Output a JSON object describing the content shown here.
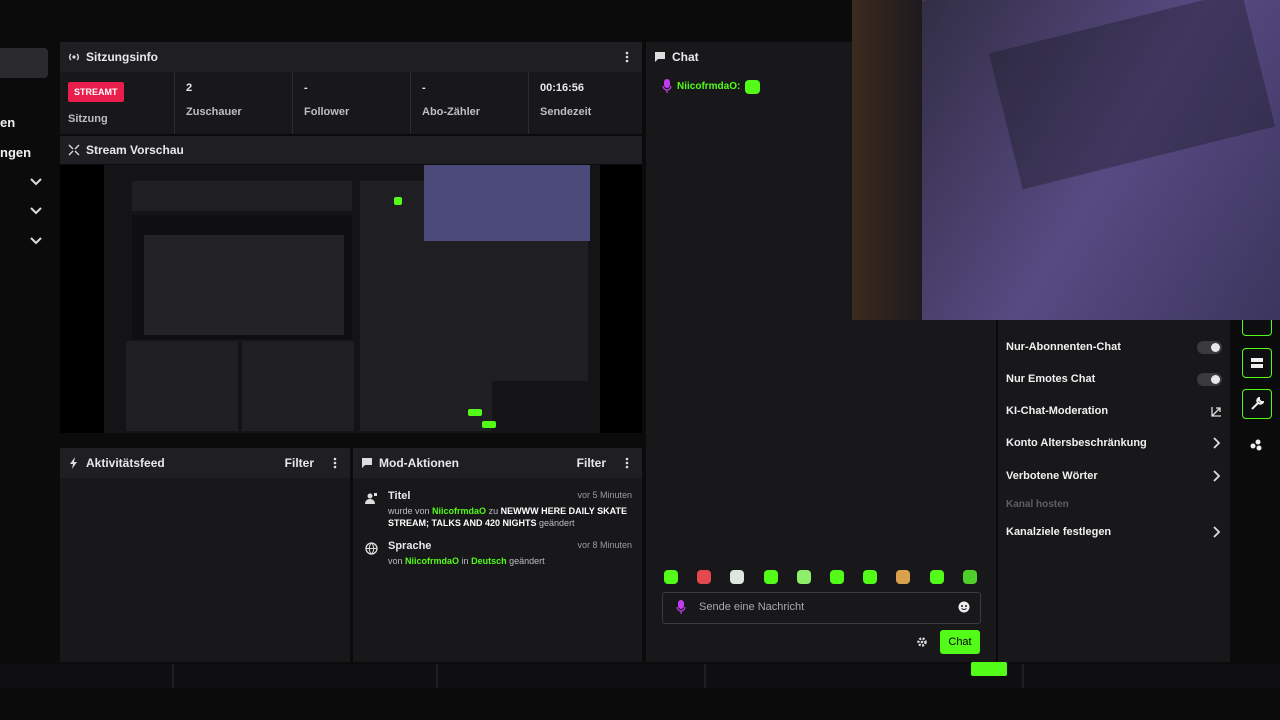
{
  "sidebar": {
    "labels": [
      "en",
      "ngen"
    ]
  },
  "session": {
    "title": "Sitzungsinfo",
    "live_badge": "STREAMT",
    "session_label": "Sitzung",
    "stats": [
      {
        "value": "2",
        "label": "Zuschauer"
      },
      {
        "value": "-",
        "label": "Follower"
      },
      {
        "value": "-",
        "label": "Abo-Zähler"
      },
      {
        "value": "00:16:56",
        "label": "Sendezeit"
      }
    ]
  },
  "preview": {
    "title": "Stream Vorschau"
  },
  "activity": {
    "title": "Aktivitätsfeed",
    "filter": "Filter"
  },
  "mod_actions": {
    "title": "Mod-Aktionen",
    "filter": "Filter",
    "items": [
      {
        "title": "Titel",
        "ago": "vor 5 Minuten",
        "pre": "wurde von",
        "user": "NiicofrmdaO",
        "mid": "zu",
        "target": "NEWWW HERE DAILY SKATE STREAM; TALKS AND 420 NIGHTS",
        "post": "geändert"
      },
      {
        "title": "Sprache",
        "ago": "vor 8 Minuten",
        "pre": "von",
        "user": "NiicofrmdaO",
        "mid": "in",
        "target": "Deutsch",
        "post": "geändert"
      }
    ]
  },
  "chat": {
    "title": "Chat",
    "message_user": "NiicofrmdaO:",
    "input_placeholder": "Sende eine Nachricht",
    "send_label": "Chat",
    "emote_count": 10
  },
  "channel_menu": {
    "items": [
      {
        "label": "Nur-Abonnenten-Chat",
        "control": "toggle",
        "state": false
      },
      {
        "label": "Nur Emotes Chat",
        "control": "toggle",
        "state": false
      },
      {
        "label": "KI-Chat-Moderation",
        "control": "external-icon"
      },
      {
        "label": "Konto Altersbeschränkung",
        "control": "chevron-right-icon"
      },
      {
        "label": "Verbotene Wörter",
        "control": "chevron-right-icon"
      },
      {
        "label": "Kanal hosten",
        "control": "disabled"
      },
      {
        "label": "Kanalziele festlegen",
        "control": "chevron-right-icon"
      }
    ]
  },
  "colors": {
    "accent": "#53fc18",
    "live": "#e91e4d",
    "panel": "#18181b",
    "header": "#1f1f23"
  },
  "icons": [
    "broadcast-icon",
    "kebab-icon",
    "expand-icon",
    "bolt-icon",
    "chat-bubble-icon",
    "user-edit-icon",
    "globe-icon",
    "mic-icon",
    "smile-icon",
    "gear-icon",
    "chevron-down-icon",
    "chevron-right-icon"
  ]
}
